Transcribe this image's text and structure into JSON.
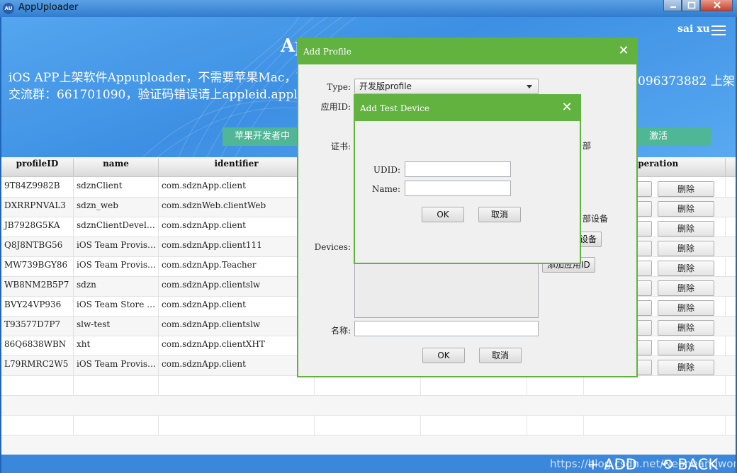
{
  "window": {
    "title": "AppUploader",
    "icon_text": "AU",
    "minimize_icon": "minimize-icon",
    "maximize_icon": "maximize-icon",
    "close_icon": "close-icon"
  },
  "header": {
    "heading": "App",
    "info_line1": "iOS APP上架软件Appuploader，不需要苹果Mac，Wi",
    "info_line2": "交流群：661701090，验证码错误请上appleid.apple.co",
    "info_right": "096373882 上架",
    "user_name": "sai xu",
    "menu_icon": "hamburger-menu-icon",
    "dev_center_button": "苹果开发者中",
    "activate_button": "激活"
  },
  "table": {
    "columns": [
      "profileID",
      "name",
      "identifier",
      "",
      "",
      "",
      "Operation"
    ],
    "delete_label": "删除",
    "rows": [
      {
        "profileID": "9T84Z9982B",
        "name": "sdznClient",
        "identifier": "com.sdznApp.client"
      },
      {
        "profileID": "DXRRPNVAL3",
        "name": "sdzn_web",
        "identifier": "com.sdznWeb.clientWeb"
      },
      {
        "profileID": "JB7928G5KA",
        "name": "sdznClientDevelopm...",
        "identifier": "com.sdznApp.client"
      },
      {
        "profileID": "Q8J8NTBG56",
        "name": "iOS Team Provisioni...",
        "identifier": "com.sdznApp.client111"
      },
      {
        "profileID": "MW739BGY86",
        "name": "iOS Team Provisioni...",
        "identifier": "com.sdznApp.Teacher"
      },
      {
        "profileID": "WB8NM2B5P7",
        "name": "sdzn",
        "identifier": "com.sdznApp.clientslw"
      },
      {
        "profileID": "BVY24VP936",
        "name": "iOS Team Store Prov...",
        "identifier": "com.sdznApp.client"
      },
      {
        "profileID": "T93577D7P7",
        "name": "slw-test",
        "identifier": "com.sdznApp.clientslw"
      },
      {
        "profileID": "86Q6838WBN",
        "name": "xht",
        "identifier": "com.sdznApp.clientXHT"
      },
      {
        "profileID": "L79RMRC2W5",
        "name": "iOS Team Provisioni...",
        "identifier": "com.sdznApp.client"
      }
    ]
  },
  "footer": {
    "watermark": "https://blog.csdn.net/Neoneandworl",
    "add_label": "+ ADD",
    "back_label": "⟲ BACK"
  },
  "add_profile": {
    "title": "Add Profile",
    "close_icon": "close-icon",
    "type_label": "Type:",
    "type_value": "开发版profile",
    "appid_label": "应用ID:",
    "cert_label": "证书:",
    "devices_label": "Devices:",
    "name_label": "名称:",
    "name_value": "",
    "side_text1": "部",
    "side_text2": "部设备",
    "side_button1": "设备",
    "side_button2": "添加应用ID",
    "ok_button": "OK",
    "cancel_button": "取消"
  },
  "add_device": {
    "title": "Add Test Device",
    "close_icon": "close-icon",
    "udid_label": "UDID:",
    "udid_value": "",
    "name_label": "Name:",
    "name_value": "",
    "ok_button": "OK",
    "cancel_button": "取消"
  }
}
